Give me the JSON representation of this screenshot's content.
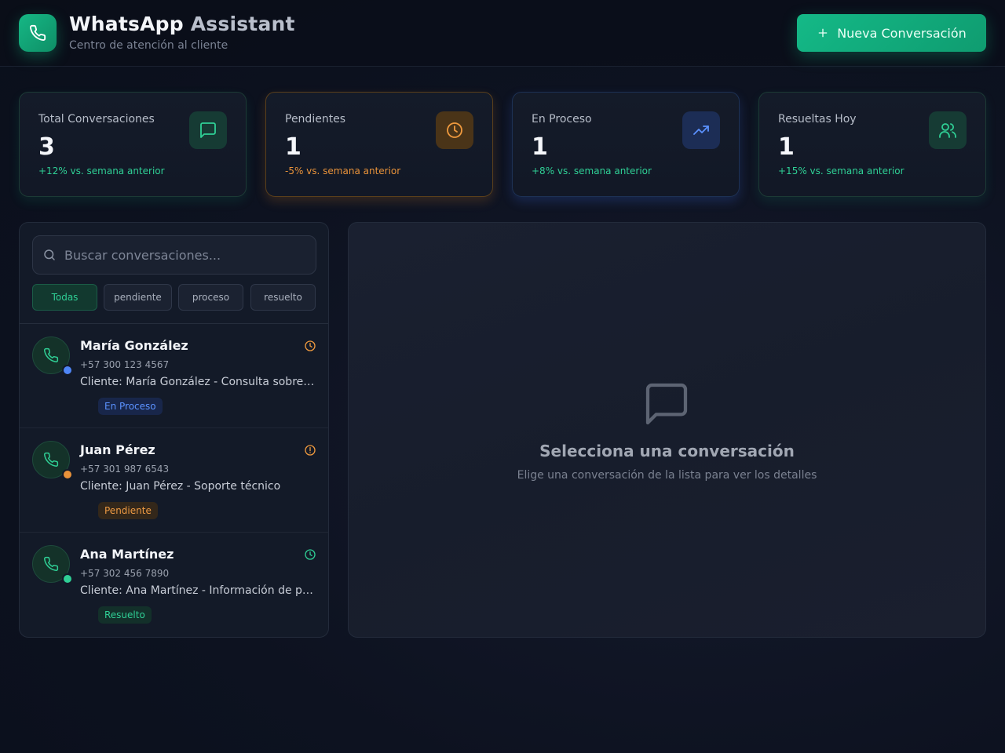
{
  "header": {
    "title_part1": "WhatsApp",
    "title_part2": "Assistant",
    "subtitle": "Centro de atención al cliente",
    "new_conversation_label": "Nueva Conversación"
  },
  "stats": [
    {
      "label": "Total Conversaciones",
      "value": "3",
      "change": "+12% vs. semana anterior",
      "icon": "message-icon",
      "accent": "#2fcf95"
    },
    {
      "label": "Pendientes",
      "value": "1",
      "change": "-5% vs. semana anterior",
      "icon": "clock-icon",
      "accent": "#e8923a"
    },
    {
      "label": "En Proceso",
      "value": "1",
      "change": "+8% vs. semana anterior",
      "icon": "trending-up-icon",
      "accent": "#4f86f7"
    },
    {
      "label": "Resueltas Hoy",
      "value": "1",
      "change": "+15% vs. semana anterior",
      "icon": "users-icon",
      "accent": "#2fcf95"
    }
  ],
  "search": {
    "placeholder": "Buscar conversaciones...",
    "value": ""
  },
  "filters": [
    {
      "label": "Todas",
      "active": true
    },
    {
      "label": "pendiente",
      "active": false
    },
    {
      "label": "proceso",
      "active": false
    },
    {
      "label": "resuelto",
      "active": false
    }
  ],
  "conversations": [
    {
      "name": "María González",
      "phone": "+57 300 123 4567",
      "preview": "Cliente: María González - Consulta sobre productos",
      "status": "En Proceso",
      "status_color": "#4f86f7"
    },
    {
      "name": "Juan Pérez",
      "phone": "+57 301 987 6543",
      "preview": "Cliente: Juan Pérez - Soporte técnico",
      "status": "Pendiente",
      "status_color": "#e8923a"
    },
    {
      "name": "Ana Martínez",
      "phone": "+57 302 456 7890",
      "preview": "Cliente: Ana Martínez - Información de pedidos",
      "status": "Resuelto",
      "status_color": "#2fcf95"
    }
  ],
  "empty_state": {
    "title": "Selecciona una conversación",
    "subtitle": "Elige una conversación de la lista para ver los detalles"
  }
}
